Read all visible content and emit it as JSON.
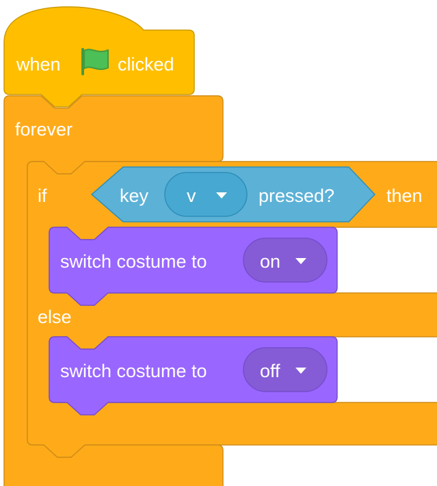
{
  "script": {
    "hat": {
      "label_when": "when",
      "flag_icon": "green-flag-icon",
      "label_clicked": "clicked"
    },
    "forever": {
      "label": "forever"
    },
    "if_else": {
      "label_if": "if",
      "label_then": "then",
      "label_else": "else",
      "condition": {
        "label_key": "key",
        "key_value": "v",
        "label_pressed": "pressed?"
      }
    },
    "costume_on": {
      "label": "switch costume to",
      "value": "on"
    },
    "costume_off": {
      "label": "switch costume to",
      "value": "off"
    }
  },
  "colors": {
    "events": "#FFBF00",
    "events_border": "#CC9900",
    "control": "#FFAB19",
    "control_border": "#CF8B17",
    "sensing": "#5CB1D6",
    "sensing_border": "#2E8EB8",
    "sensing_dark": "#47A8D1",
    "looks": "#9966FF",
    "looks_border": "#774DCB",
    "looks_dark": "#855CD6",
    "flag_green": "#4CBF56",
    "flag_border": "#45993D"
  }
}
